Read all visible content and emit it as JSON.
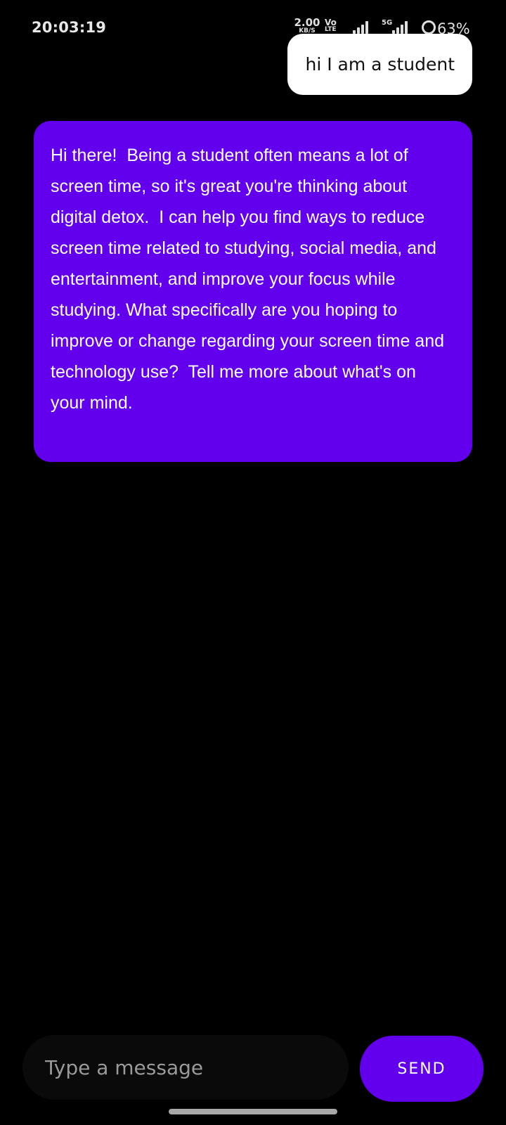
{
  "status_bar": {
    "time": "20:03:19",
    "net_speed_value": "2.00",
    "net_speed_unit": "KB/S",
    "volte_label": "Vo",
    "lte_label": "LTE",
    "fiveg_label": "5G",
    "battery": "63%"
  },
  "chat": {
    "messages": [
      {
        "sender": "user",
        "text": "hi I am a student"
      },
      {
        "sender": "bot",
        "text": "Hi there!  Being a student often means a lot of screen time, so it's great you're thinking about digital detox.  I can help you find ways to reduce screen time related to studying, social media, and entertainment, and improve your focus while studying. What specifically are you hoping to improve or change regarding your screen time and technology use?  Tell me more about what's on your mind."
      }
    ]
  },
  "composer": {
    "placeholder": "Type a message",
    "value": "",
    "send_label": "SEND"
  },
  "colors": {
    "accent": "#6200ee",
    "background": "#000000",
    "user_bubble": "#ffffff",
    "input_bg": "#0a0a0a"
  }
}
